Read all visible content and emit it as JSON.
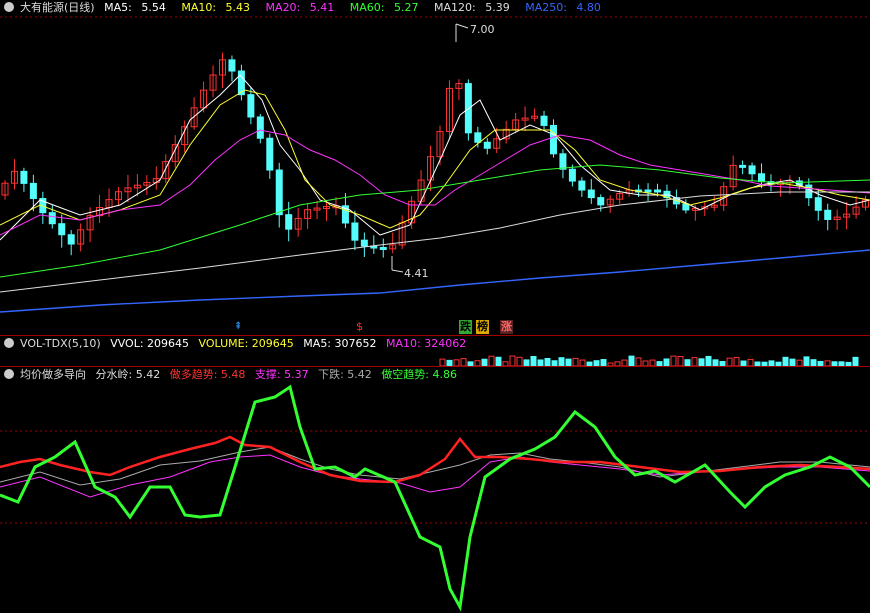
{
  "main": {
    "title": "大有能源(日线)",
    "ma": [
      {
        "label": "MA5:",
        "value": "5.54",
        "color": "#ffffff"
      },
      {
        "label": "MA10:",
        "value": "5.43",
        "color": "#ffff33"
      },
      {
        "label": "MA20:",
        "value": "5.41",
        "color": "#ff33ff"
      },
      {
        "label": "MA60:",
        "value": "5.27",
        "color": "#33ff33"
      },
      {
        "label": "MA120:",
        "value": "5.39",
        "color": "#dddddd"
      },
      {
        "label": "MA250:",
        "value": "4.80",
        "color": "#3366ff"
      }
    ],
    "high_label": "7.00",
    "low_label": "4.41",
    "signals": {
      "s1": "跌",
      "s2": "榜",
      "s3": "涨"
    }
  },
  "vol": {
    "name": "VOL-TDX(5,10)",
    "vvol": "VVOL: 209645",
    "volume": "VOLUME: 209645",
    "ma5": "MA5: 307652",
    "ma10": "MA10: 324062"
  },
  "ind": {
    "name": "均价做多导向",
    "fsl": "分水岭: 5.42",
    "zd": "做多趋势: 5.48",
    "zc": "支撑: 5.37",
    "xd": "下跌: 5.42",
    "zk": "做空趋势: 4.86"
  },
  "colors": {
    "up": "#ff3232",
    "down": "#54fcfc",
    "grid": "#a00000",
    "green": "#33ff33"
  }
}
